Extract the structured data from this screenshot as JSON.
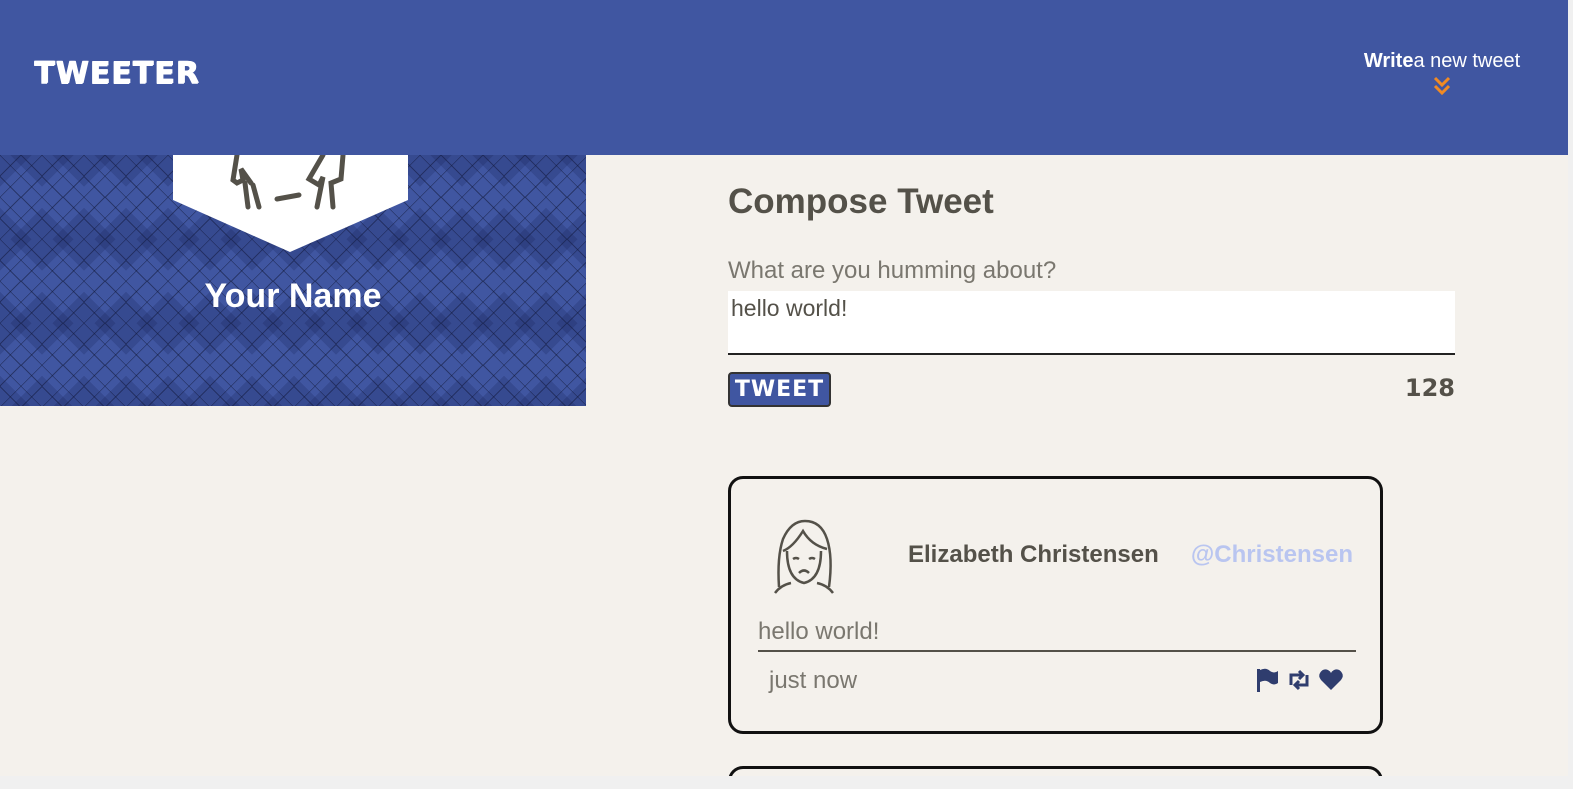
{
  "nav": {
    "brand": "TWEETER",
    "write_bold": "Write",
    "write_rest": "a new tweet",
    "write_icon": "double-chevron-down-icon"
  },
  "profile": {
    "name": "Your Name",
    "avatar_icon": "user-avatar-icon"
  },
  "compose": {
    "title": "Compose Tweet",
    "label": "What are you humming about?",
    "value": "hello world!",
    "button_label": "TWEET",
    "counter": "128"
  },
  "tweets": [
    {
      "name": "Elizabeth Christensen",
      "handle": "@Christensen",
      "content": "hello world!",
      "time": "just now",
      "actions": [
        "flag-icon",
        "retweet-icon",
        "heart-icon"
      ]
    }
  ],
  "colors": {
    "nav_bg": "#4056a1",
    "page_bg": "#f4f1ec",
    "accent": "#f08a24",
    "handle": "#b9c5f0",
    "text": "#545149"
  }
}
